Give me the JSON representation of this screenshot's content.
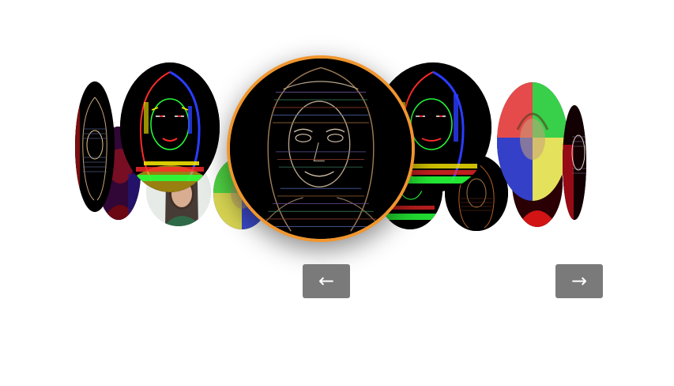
{
  "carousel": {
    "nav": {
      "prev_label": "←",
      "next_label": "→"
    },
    "items": [
      {
        "name": "slide-far-left-edge",
        "filter": "edge-glitch",
        "accent": "#c0392b"
      },
      {
        "name": "slide-far-left-red",
        "filter": "red-tint",
        "accent": "#5a0a10"
      },
      {
        "name": "slide-left-edge-color",
        "filter": "edge-color",
        "accent": "#00ff22"
      },
      {
        "name": "slide-left-photo",
        "filter": "original",
        "accent": "#2f5a3a"
      },
      {
        "name": "slide-left-quad",
        "filter": "quad-tint",
        "accent": "#d6d645"
      },
      {
        "name": "slide-center-active",
        "filter": "edge-glitch",
        "accent": "#f0962e"
      },
      {
        "name": "slide-right-edge-color",
        "filter": "edge-color",
        "accent": "#00ff22"
      },
      {
        "name": "slide-right-edge-small",
        "filter": "edge-color",
        "accent": "#00ff22"
      },
      {
        "name": "slide-right-edge-dark",
        "filter": "edge-glitch",
        "accent": "#b8602a"
      },
      {
        "name": "slide-right-quad",
        "filter": "quad-tint",
        "accent": "#2ed22e"
      },
      {
        "name": "slide-right-red",
        "filter": "red-tint",
        "accent": "#7a0000"
      },
      {
        "name": "slide-far-right-edge",
        "filter": "edge-glitch",
        "accent": "#c0392b"
      }
    ]
  }
}
